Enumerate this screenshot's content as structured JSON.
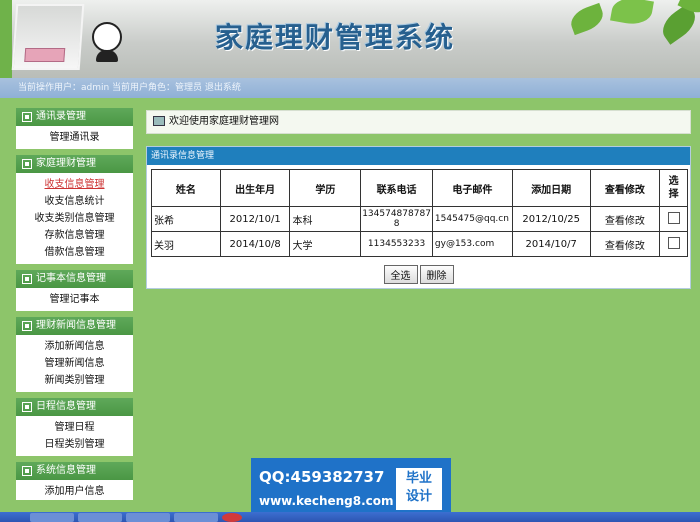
{
  "banner": {
    "title": "家庭理财管理系统"
  },
  "infobar": {
    "text": "当前操作用户：admin 当前用户角色：管理员  退出系统"
  },
  "sidebar": {
    "groups": [
      {
        "title": "通讯录管理",
        "items": [
          "管理通讯录"
        ]
      },
      {
        "title": "家庭理财管理",
        "items": [
          "收支信息管理",
          "收支信息统计",
          "收支类别信息管理",
          "存款信息管理",
          "借款信息管理"
        ]
      },
      {
        "title": "记事本信息管理",
        "items": [
          "管理记事本"
        ]
      },
      {
        "title": "理财新闻信息管理",
        "items": [
          "添加新闻信息",
          "管理新闻信息",
          "新闻类别管理"
        ]
      },
      {
        "title": "日程信息管理",
        "items": [
          "管理日程",
          "日程类别管理"
        ]
      },
      {
        "title": "系统信息管理",
        "items": [
          "添加用户信息"
        ]
      }
    ]
  },
  "main": {
    "welcome": "欢迎使用家庭理财管理网",
    "panel_title": "通讯录信息管理",
    "columns": [
      "姓名",
      "出生年月",
      "学历",
      "联系电话",
      "电子邮件",
      "添加日期",
      "查看修改",
      "选择"
    ],
    "rows": [
      {
        "name": "张希",
        "birth": "2012/10/1",
        "edu": "本科",
        "phone": "134574878787​8",
        "email": "1545475@qq.cn",
        "added": "2012/10/25",
        "action": "查看修改"
      },
      {
        "name": "关羽",
        "birth": "2014/10/8",
        "edu": "大学",
        "phone": "1134553233",
        "email": "gy@153.com",
        "added": "2014/10/7",
        "action": "查看修改"
      }
    ],
    "select_all": "全选",
    "delete": "删除"
  },
  "watermark": {
    "qq": "QQ:459382737",
    "site": "www.kecheng8.com",
    "badge1": "毕业",
    "badge2": "设计"
  },
  "colors": {
    "background": "#8dc56a",
    "sidebar_header": "#4a9744",
    "panel_header": "#1f7fbd",
    "title": "#27608f"
  }
}
